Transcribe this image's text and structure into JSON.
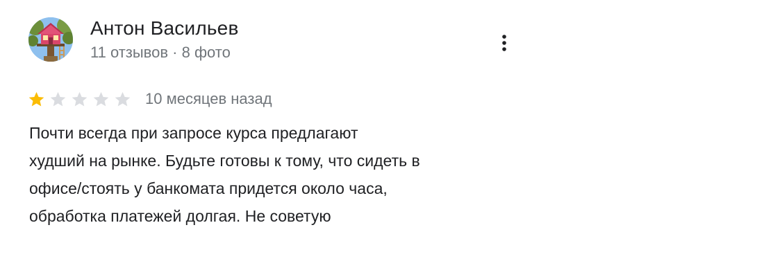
{
  "review": {
    "author": {
      "name": "Антон Васильев",
      "meta": "11 отзывов · 8 фото",
      "avatar_icon": "treehouse-avatar-icon"
    },
    "menu_icon": "more-vert-icon",
    "rating": {
      "value": 1,
      "max": 5,
      "filled_color": "#fbbc04",
      "empty_color": "#dadce0"
    },
    "date": "10 месяцев назад",
    "text": "Почти всегда при запросе курса предлагают\nхудший на рынке. Будьте готовы к тому, что сидеть в\nофисе/стоять у банкомата придется около часа,\nобработка платежей долгая. Не советую"
  }
}
